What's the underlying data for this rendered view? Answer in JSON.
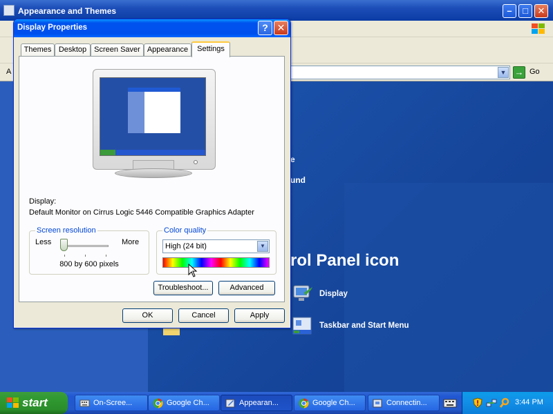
{
  "background_window": {
    "title": "Appearance and Themes",
    "min_label": "–",
    "max_label": "□",
    "close_label": "✕",
    "address_bar_prefix": "A",
    "go_label": "Go",
    "content_snippet_1": "e",
    "content_snippet_2": "und",
    "heading_partial": "rol Panel icon",
    "control_panel_items": [
      {
        "label": "Display",
        "icon": "display-icon"
      },
      {
        "label": "Taskbar and Start Menu",
        "icon": "taskbar-icon"
      }
    ]
  },
  "dialog": {
    "title": "Display Properties",
    "help_label": "?",
    "close_label": "✕",
    "tabs": [
      {
        "label": "Themes",
        "selected": false
      },
      {
        "label": "Desktop",
        "selected": false
      },
      {
        "label": "Screen Saver",
        "selected": false
      },
      {
        "label": "Appearance",
        "selected": false
      },
      {
        "label": "Settings",
        "selected": true
      }
    ],
    "display_label": "Display:",
    "display_value": "Default Monitor on Cirrus Logic 5446 Compatible Graphics Adapter",
    "screen_resolution": {
      "legend": "Screen resolution",
      "less_label": "Less",
      "more_label": "More",
      "value": "800 by 600 pixels",
      "slider_position": 0
    },
    "color_quality": {
      "legend": "Color quality",
      "selected": "High (24 bit)"
    },
    "buttons": {
      "troubleshoot": "Troubleshoot...",
      "advanced": "Advanced",
      "ok": "OK",
      "cancel": "Cancel",
      "apply": "Apply"
    }
  },
  "taskbar": {
    "start_label": "start",
    "tasks": [
      {
        "label": "On-Scree...",
        "icon": "keyboard-icon",
        "active": false
      },
      {
        "label": "Google Ch...",
        "icon": "chrome-icon",
        "active": false
      },
      {
        "label": "Appearan...",
        "icon": "folder-icon",
        "active": true
      },
      {
        "label": "Google Ch...",
        "icon": "chrome-icon",
        "active": false
      },
      {
        "label": "Connectin...",
        "icon": "network-window-icon",
        "active": false
      }
    ],
    "clock": "3:44 PM"
  },
  "colors": {
    "desktop_blue": "#0c3a86",
    "title_blue": "#0050ee",
    "start_green": "#319a31",
    "legend_blue": "#0046d5"
  }
}
